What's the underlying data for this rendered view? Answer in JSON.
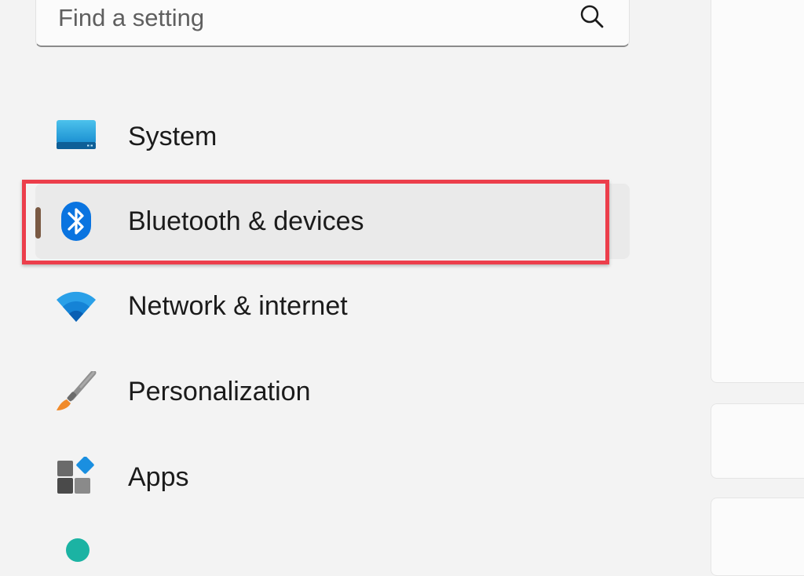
{
  "search": {
    "placeholder": "Find a setting"
  },
  "nav": {
    "items": [
      {
        "id": "system",
        "label": "System",
        "icon": "system-monitor-icon"
      },
      {
        "id": "bluetooth",
        "label": "Bluetooth & devices",
        "icon": "bluetooth-icon",
        "selected": true
      },
      {
        "id": "network",
        "label": "Network & internet",
        "icon": "wifi-icon"
      },
      {
        "id": "personalization",
        "label": "Personalization",
        "icon": "paintbrush-icon"
      },
      {
        "id": "apps",
        "label": "Apps",
        "icon": "apps-icon"
      }
    ]
  },
  "colors": {
    "background": "#f3f3f3",
    "highlight_border": "#ec3e4b",
    "selection_pill": "#7a5a44",
    "bluetooth_blue": "#0a74e0"
  }
}
